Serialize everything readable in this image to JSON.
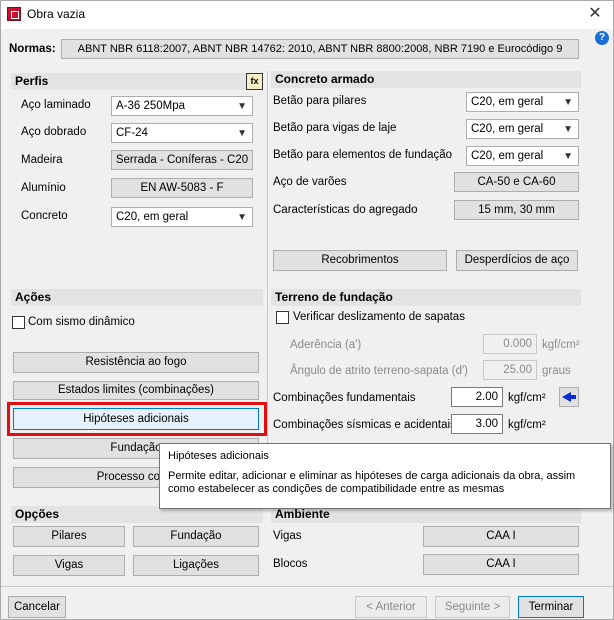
{
  "window": {
    "title": "Obra vazia",
    "close_glyph": "✕"
  },
  "normas": {
    "label": "Normas:",
    "value": "ABNT NBR 6118:2007, ABNT NBR 14762: 2010, ABNT NBR 8800:2008, NBR 7190 e Eurocódigo 9"
  },
  "perfis": {
    "title": "Perfis",
    "rows": [
      {
        "label": "Aço laminado",
        "value": "A-36 250Mpa"
      },
      {
        "label": "Aço dobrado",
        "value": "CF-24"
      },
      {
        "label": "Madeira",
        "value": "Serrada - Coníferas - C20"
      },
      {
        "label": "Alumínio",
        "value": "EN AW-5083 - F"
      },
      {
        "label": "Concreto",
        "value": "C20, em geral"
      }
    ]
  },
  "concreto": {
    "title": "Concreto armado",
    "rows": [
      {
        "label": "Betão para pilares",
        "value": "C20, em geral"
      },
      {
        "label": "Betão para vigas de laje",
        "value": "C20, em geral"
      },
      {
        "label": "Betão para elementos de fundação",
        "value": "C20, em geral"
      },
      {
        "label": "Aço de varões",
        "value": "CA-50 e CA-60"
      },
      {
        "label": "Características do agregado",
        "value": "15 mm, 30 mm"
      }
    ],
    "recobrimentos": "Recobrimentos",
    "desperdicios": "Desperdícios de aço"
  },
  "acoes": {
    "title": "Ações",
    "sismo": "Com sismo dinâmico",
    "resistencia": "Resistência ao fogo",
    "estados": "Estados limites (combinações)",
    "hipoteses": "Hipóteses adicionais",
    "fundacao": "Fundação",
    "processo": "Processo const"
  },
  "terreno": {
    "title": "Terreno de fundação",
    "verificar": "Verificar deslizamento de sapatas",
    "aderencia_label": "Aderência (a')",
    "aderencia_value": "0.000",
    "aderencia_unit": "kgf/cm²",
    "angulo_label": "Ângulo de atrito terreno-sapata (d')",
    "angulo_value": "25.00",
    "angulo_unit": "graus",
    "comb_fund_label": "Combinações fundamentais",
    "comb_fund_value": "2.00",
    "comb_fund_unit": "kgf/cm²",
    "comb_sism_label": "Combinações sísmicas e acidentais",
    "comb_sism_value": "3.00",
    "comb_sism_unit": "kgf/cm²"
  },
  "opcoes": {
    "title": "Opções",
    "pilares": "Pilares",
    "fundacao": "Fundação",
    "vigas": "Vigas",
    "ligacoes": "Ligações"
  },
  "ambiente": {
    "title": "Ambiente",
    "rows": [
      {
        "label": "Vigas",
        "value": "CAA I"
      },
      {
        "label": "Blocos",
        "value": "CAA I"
      }
    ]
  },
  "tooltip": {
    "title": "Hipóteses adicionais",
    "body": "Permite editar, adicionar e eliminar as hipóteses de carga adicionais da obra, assim como estabelecer as condições de compatibilidade entre as mesmas"
  },
  "footer": {
    "cancelar": "Cancelar",
    "anterior": "< Anterior",
    "seguinte": "Seguinte >",
    "terminar": "Terminar"
  },
  "help_glyph": "?",
  "fx_glyph": "fx",
  "colors": {
    "highlight": "#e01010",
    "arrow": "#0a2ad8",
    "help": "#1a6fd6"
  }
}
